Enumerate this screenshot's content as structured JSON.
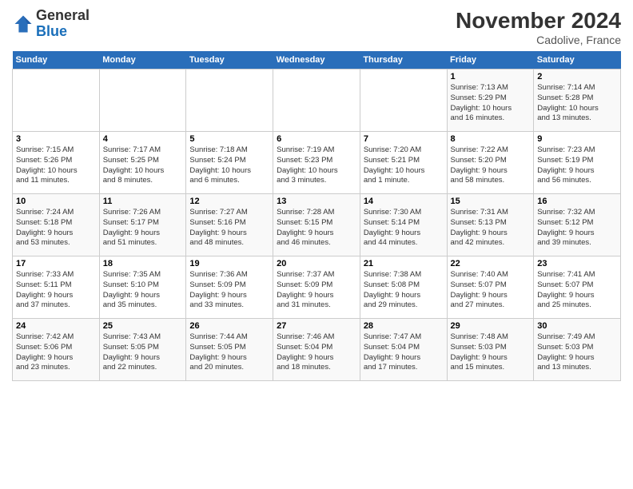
{
  "header": {
    "logo_line1": "General",
    "logo_line2": "Blue",
    "month_year": "November 2024",
    "location": "Cadolive, France"
  },
  "weekdays": [
    "Sunday",
    "Monday",
    "Tuesday",
    "Wednesday",
    "Thursday",
    "Friday",
    "Saturday"
  ],
  "weeks": [
    [
      {
        "day": "",
        "info": ""
      },
      {
        "day": "",
        "info": ""
      },
      {
        "day": "",
        "info": ""
      },
      {
        "day": "",
        "info": ""
      },
      {
        "day": "",
        "info": ""
      },
      {
        "day": "1",
        "info": "Sunrise: 7:13 AM\nSunset: 5:29 PM\nDaylight: 10 hours\nand 16 minutes."
      },
      {
        "day": "2",
        "info": "Sunrise: 7:14 AM\nSunset: 5:28 PM\nDaylight: 10 hours\nand 13 minutes."
      }
    ],
    [
      {
        "day": "3",
        "info": "Sunrise: 7:15 AM\nSunset: 5:26 PM\nDaylight: 10 hours\nand 11 minutes."
      },
      {
        "day": "4",
        "info": "Sunrise: 7:17 AM\nSunset: 5:25 PM\nDaylight: 10 hours\nand 8 minutes."
      },
      {
        "day": "5",
        "info": "Sunrise: 7:18 AM\nSunset: 5:24 PM\nDaylight: 10 hours\nand 6 minutes."
      },
      {
        "day": "6",
        "info": "Sunrise: 7:19 AM\nSunset: 5:23 PM\nDaylight: 10 hours\nand 3 minutes."
      },
      {
        "day": "7",
        "info": "Sunrise: 7:20 AM\nSunset: 5:21 PM\nDaylight: 10 hours\nand 1 minute."
      },
      {
        "day": "8",
        "info": "Sunrise: 7:22 AM\nSunset: 5:20 PM\nDaylight: 9 hours\nand 58 minutes."
      },
      {
        "day": "9",
        "info": "Sunrise: 7:23 AM\nSunset: 5:19 PM\nDaylight: 9 hours\nand 56 minutes."
      }
    ],
    [
      {
        "day": "10",
        "info": "Sunrise: 7:24 AM\nSunset: 5:18 PM\nDaylight: 9 hours\nand 53 minutes."
      },
      {
        "day": "11",
        "info": "Sunrise: 7:26 AM\nSunset: 5:17 PM\nDaylight: 9 hours\nand 51 minutes."
      },
      {
        "day": "12",
        "info": "Sunrise: 7:27 AM\nSunset: 5:16 PM\nDaylight: 9 hours\nand 48 minutes."
      },
      {
        "day": "13",
        "info": "Sunrise: 7:28 AM\nSunset: 5:15 PM\nDaylight: 9 hours\nand 46 minutes."
      },
      {
        "day": "14",
        "info": "Sunrise: 7:30 AM\nSunset: 5:14 PM\nDaylight: 9 hours\nand 44 minutes."
      },
      {
        "day": "15",
        "info": "Sunrise: 7:31 AM\nSunset: 5:13 PM\nDaylight: 9 hours\nand 42 minutes."
      },
      {
        "day": "16",
        "info": "Sunrise: 7:32 AM\nSunset: 5:12 PM\nDaylight: 9 hours\nand 39 minutes."
      }
    ],
    [
      {
        "day": "17",
        "info": "Sunrise: 7:33 AM\nSunset: 5:11 PM\nDaylight: 9 hours\nand 37 minutes."
      },
      {
        "day": "18",
        "info": "Sunrise: 7:35 AM\nSunset: 5:10 PM\nDaylight: 9 hours\nand 35 minutes."
      },
      {
        "day": "19",
        "info": "Sunrise: 7:36 AM\nSunset: 5:09 PM\nDaylight: 9 hours\nand 33 minutes."
      },
      {
        "day": "20",
        "info": "Sunrise: 7:37 AM\nSunset: 5:09 PM\nDaylight: 9 hours\nand 31 minutes."
      },
      {
        "day": "21",
        "info": "Sunrise: 7:38 AM\nSunset: 5:08 PM\nDaylight: 9 hours\nand 29 minutes."
      },
      {
        "day": "22",
        "info": "Sunrise: 7:40 AM\nSunset: 5:07 PM\nDaylight: 9 hours\nand 27 minutes."
      },
      {
        "day": "23",
        "info": "Sunrise: 7:41 AM\nSunset: 5:07 PM\nDaylight: 9 hours\nand 25 minutes."
      }
    ],
    [
      {
        "day": "24",
        "info": "Sunrise: 7:42 AM\nSunset: 5:06 PM\nDaylight: 9 hours\nand 23 minutes."
      },
      {
        "day": "25",
        "info": "Sunrise: 7:43 AM\nSunset: 5:05 PM\nDaylight: 9 hours\nand 22 minutes."
      },
      {
        "day": "26",
        "info": "Sunrise: 7:44 AM\nSunset: 5:05 PM\nDaylight: 9 hours\nand 20 minutes."
      },
      {
        "day": "27",
        "info": "Sunrise: 7:46 AM\nSunset: 5:04 PM\nDaylight: 9 hours\nand 18 minutes."
      },
      {
        "day": "28",
        "info": "Sunrise: 7:47 AM\nSunset: 5:04 PM\nDaylight: 9 hours\nand 17 minutes."
      },
      {
        "day": "29",
        "info": "Sunrise: 7:48 AM\nSunset: 5:03 PM\nDaylight: 9 hours\nand 15 minutes."
      },
      {
        "day": "30",
        "info": "Sunrise: 7:49 AM\nSunset: 5:03 PM\nDaylight: 9 hours\nand 13 minutes."
      }
    ]
  ]
}
